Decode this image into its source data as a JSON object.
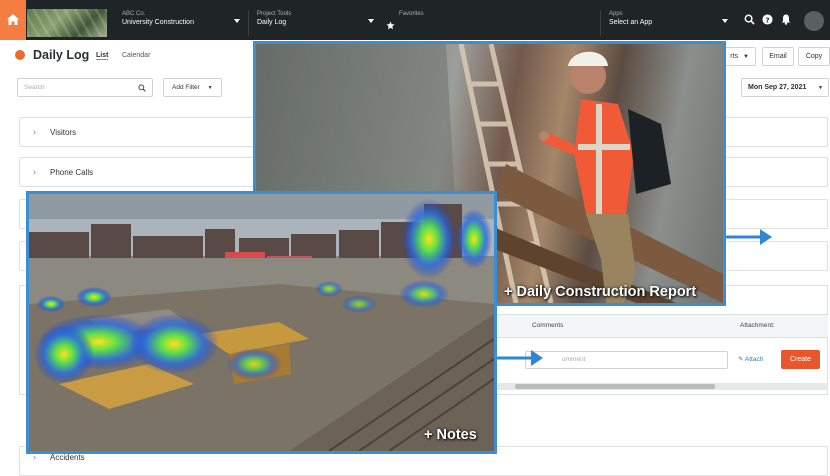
{
  "topbar": {
    "company_label": "ABC Co.",
    "company_value": "University Construction",
    "tools_label": "Project Tools",
    "tools_value": "Daily Log",
    "favorites_label": "Favorites",
    "apps_label": "Apps",
    "apps_value": "Select an App"
  },
  "header": {
    "title": "Daily Log",
    "tab_list": "List",
    "tab_calendar": "Calendar",
    "reports_partial": "rts",
    "email": "Email",
    "copy": "Copy"
  },
  "filters": {
    "search_placeholder": "Search",
    "add_filter": "Add Filter",
    "date": "Mon Sep 27, 2021"
  },
  "sections": [
    "Visitors",
    "Phone Calls",
    "Accidents"
  ],
  "table": {
    "col_comments": "Comments",
    "col_attachments": "Attachment:",
    "comment_placeholder": "omment",
    "attach": "Attach",
    "create": "Create"
  },
  "overlays": {
    "report_caption": "+ Daily Construction Report",
    "notes_caption": "+ Notes"
  },
  "colors": {
    "accent": "#e86c2d",
    "overlay_border": "#3c8ed4",
    "topbar": "#1f2426"
  }
}
